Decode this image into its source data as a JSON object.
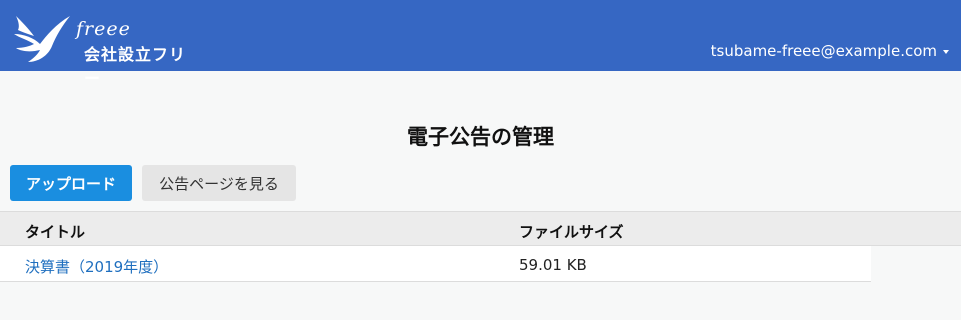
{
  "header": {
    "logo_script": "freee",
    "logo_sub": "会社設立フリー",
    "user_email": "tsubame-freee@example.com"
  },
  "main": {
    "title": "電子公告の管理",
    "upload_button": "アップロード",
    "view_page_button": "公告ページを見る",
    "table": {
      "columns": [
        "タイトル",
        "ファイルサイズ"
      ],
      "rows": [
        {
          "title": "決算書（2019年度）",
          "size": "59.01 KB"
        }
      ]
    }
  },
  "colors": {
    "header_bg": "#3667c3",
    "primary_button": "#1a8ee0",
    "link": "#1f6fbf"
  },
  "icons": {
    "logo": "swallow-icon",
    "user_menu": "caret-down-icon"
  }
}
